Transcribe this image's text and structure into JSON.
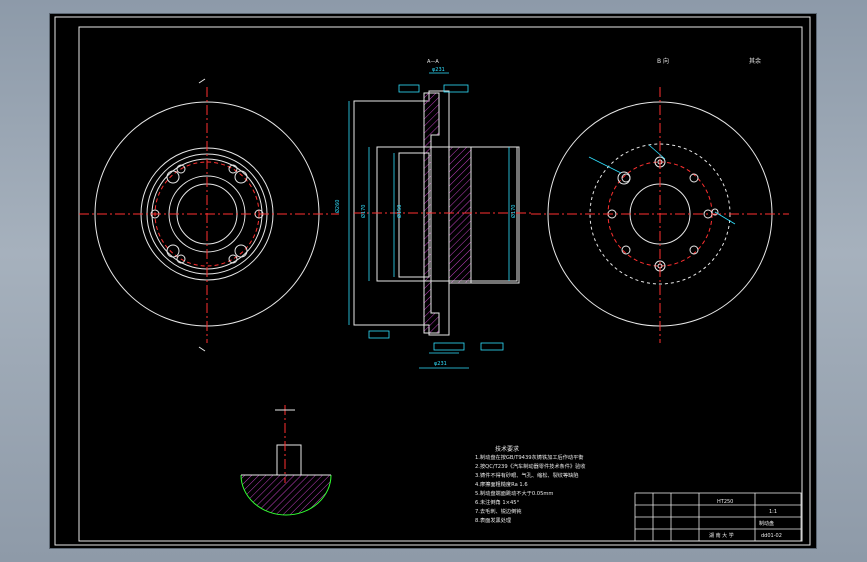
{
  "drawing": {
    "view_label_right": "B 向",
    "roughness_note": "其余",
    "section_label": "A—A",
    "tech_requirements": {
      "title": "技术要求",
      "lines": [
        "1.制动盘在按GB/T9439灰铸铁加工后作动平衡",
        "2.按QC/T239《汽车制动器零件技术条件》验收",
        "3.铸件不得有砂眼、气孔、缩松、裂纹等缺陷",
        "4.摩擦面粗糙度Ra 1.6",
        "5.制动盘端面跳动不大于0.05mm",
        "6.未注倒角 1×45°",
        "7.去毛刺、锐边倒钝",
        "8.表面发黑处理"
      ]
    },
    "title_block": {
      "part_name": "制动盘",
      "material": "HT250",
      "drawing_number": "dd01-02",
      "scale": "1:1",
      "company": "湖 南 大 学"
    }
  }
}
